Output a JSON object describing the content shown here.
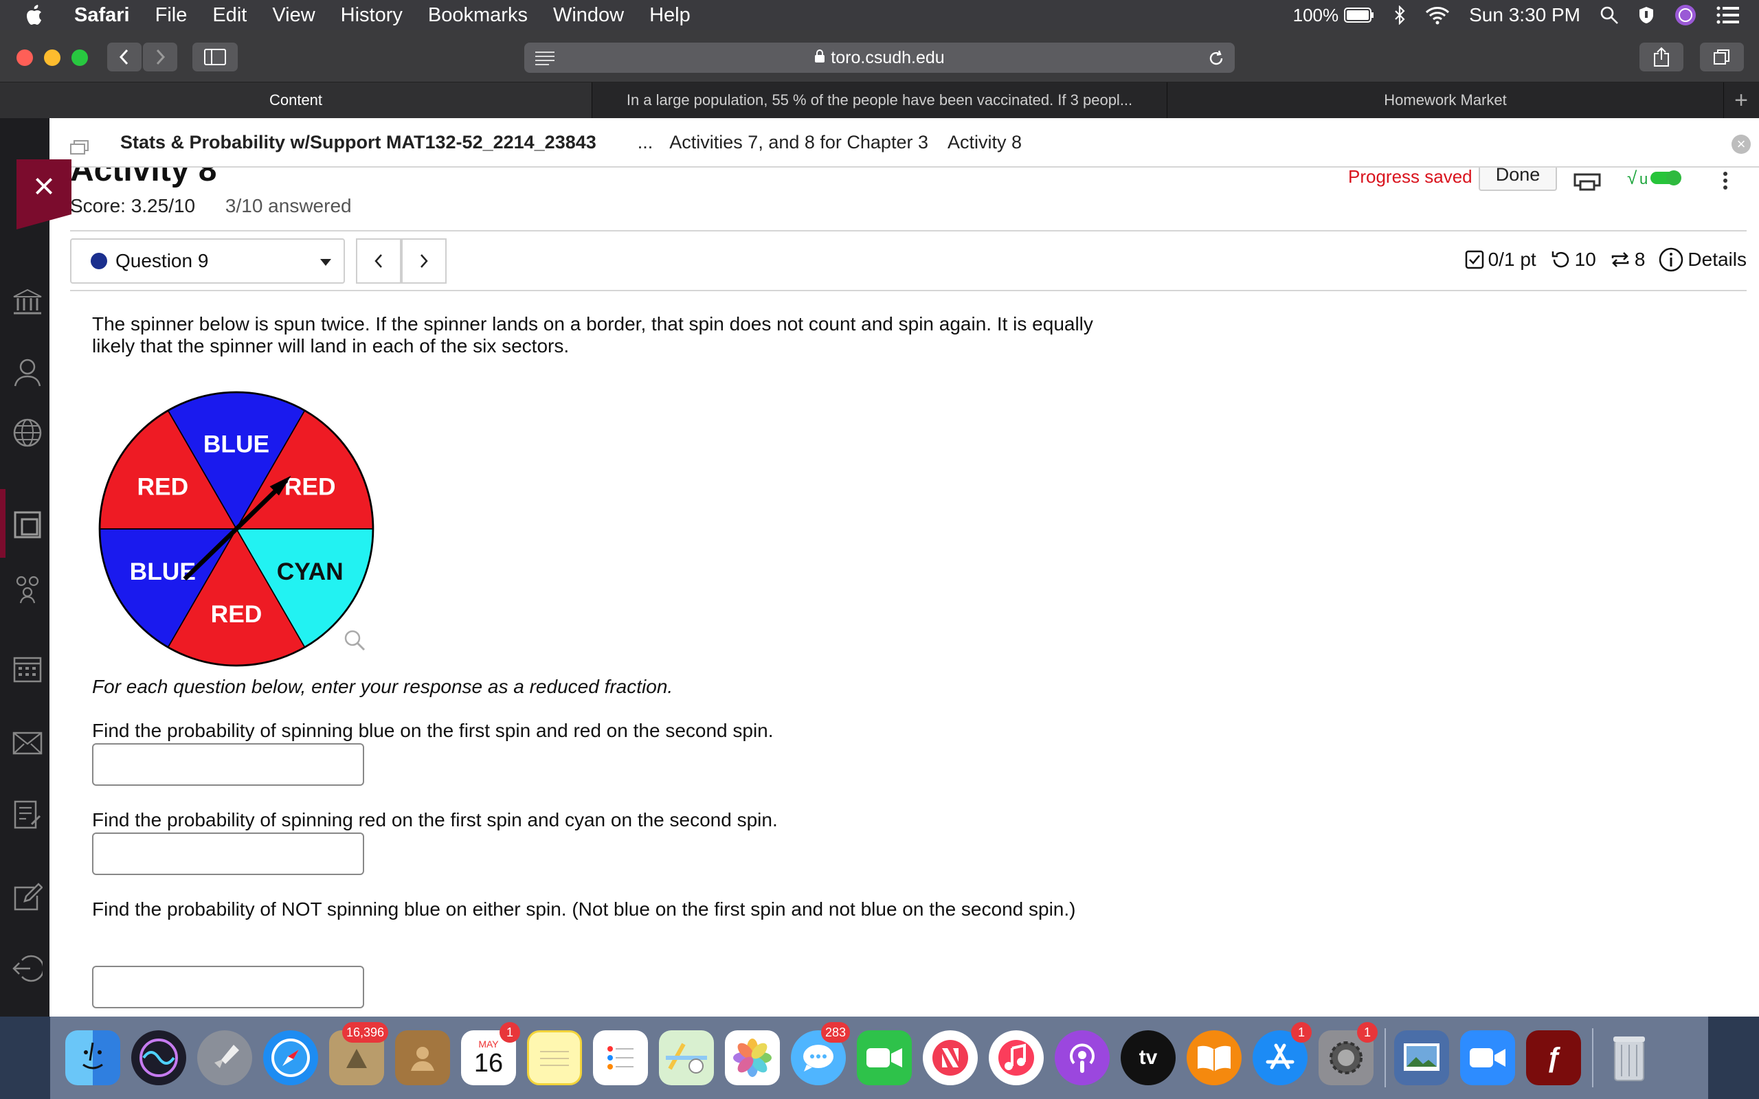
{
  "menubar": {
    "app": "Safari",
    "items": [
      "File",
      "Edit",
      "View",
      "History",
      "Bookmarks",
      "Window",
      "Help"
    ],
    "battery": "100%",
    "clock": "Sun 3:30 PM"
  },
  "browser": {
    "url": "toro.csudh.edu",
    "tabs": [
      {
        "label": "Content"
      },
      {
        "label": "In a large population, 55 % of the people have been vaccinated. If 3 peopl..."
      },
      {
        "label": "Homework Market"
      }
    ]
  },
  "breadcrumb": {
    "course": "Stats & Probability w/Support MAT132-52_2214_23843",
    "ellipsis": "...",
    "parent": "Activities 7, and 8 for Chapter 3",
    "current": "Activity 8"
  },
  "assignment": {
    "title": "Activity 8",
    "progress": "Progress saved",
    "done": "Done",
    "score": "Score: 3.25/10",
    "answered": "3/10 answered"
  },
  "question": {
    "selector": "Question 9",
    "points": "0/1 pt",
    "retries": "10",
    "attempts": "8",
    "details": "Details",
    "intro": "The spinner below is spun twice. If the spinner lands on a border, that spin does not count and spin again. It is equally likely that the spinner will land in each of the six sectors.",
    "instruction": "For each question below, enter your response as a reduced fraction.",
    "parts": [
      {
        "prompt": "Find the probability of spinning blue on the first spin and red on the second spin.",
        "value": ""
      },
      {
        "prompt": "Find the probability of spinning red on the first spin and cyan on the second spin.",
        "value": ""
      },
      {
        "prompt": "Find the probability of NOT spinning blue on either spin. (Not blue on the first spin and not blue on the second spin.)",
        "value": ""
      }
    ]
  },
  "spinner": {
    "sectors": [
      {
        "label": "BLUE",
        "color": "#1a1aee"
      },
      {
        "label": "RED",
        "color": "#ee1b24"
      },
      {
        "label": "CYAN",
        "color": "#22f2f2"
      },
      {
        "label": "RED",
        "color": "#ee1b24"
      },
      {
        "label": "BLUE",
        "color": "#1a1aee"
      },
      {
        "label": "RED",
        "color": "#ee1b24"
      }
    ]
  },
  "dock": {
    "photos_badge": "16,396",
    "calendar_month": "MAY",
    "calendar_day": "16",
    "calendar_badge": "1",
    "messages_badge": "283",
    "appstore_badge": "1",
    "settings_badge": "1",
    "tv_label": "tv"
  },
  "colors": {
    "accent_maroon": "#7b0c2d",
    "progress_red": "#d9141e",
    "question_dot": "#1b2f8e"
  }
}
